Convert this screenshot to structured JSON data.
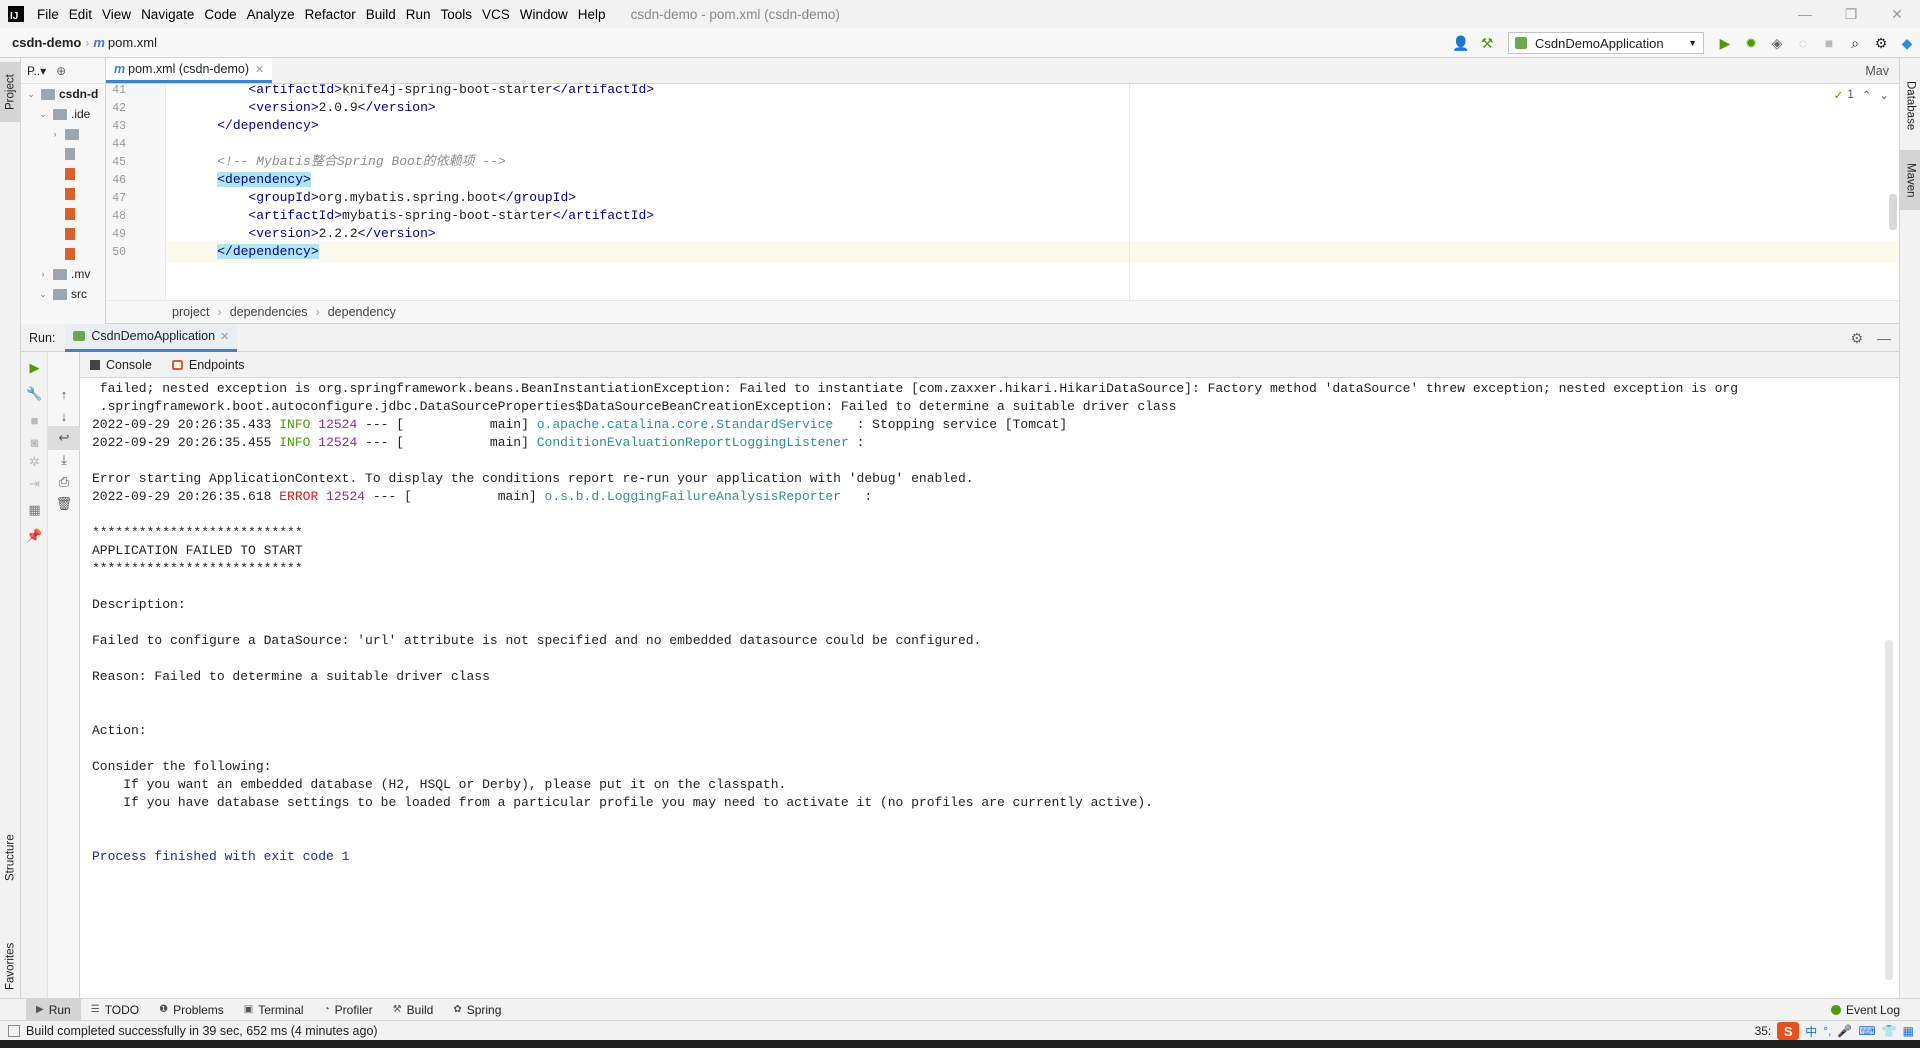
{
  "menubar": {
    "logo": "IJ",
    "items": [
      "File",
      "Edit",
      "View",
      "Navigate",
      "Code",
      "Analyze",
      "Refactor",
      "Build",
      "Run",
      "Tools",
      "VCS",
      "Window",
      "Help"
    ],
    "window_title": "csdn-demo - pom.xml (csdn-demo)"
  },
  "navbar": {
    "project": "csdn-demo",
    "file": "pom.xml",
    "run_config": "CsdnDemoApplication"
  },
  "side_tabs": {
    "project": "Project",
    "structure": "Structure",
    "favorites": "Favorites",
    "database": "Database",
    "maven": "Maven"
  },
  "project_panel": {
    "header": "P..▾",
    "rows": [
      {
        "arrow": "⌄",
        "label": "csdn-d",
        "kind": "folder",
        "bold": true
      },
      {
        "arrow": "⌄",
        "label": ".ide",
        "kind": "folder",
        "bold": false
      },
      {
        "arrow": "›",
        "label": "",
        "kind": "folder",
        "bold": false
      },
      {
        "arrow": "",
        "label": "",
        "kind": "gray",
        "bold": false
      },
      {
        "arrow": "",
        "label": "",
        "kind": "xml",
        "bold": false
      },
      {
        "arrow": "",
        "label": "",
        "kind": "xml",
        "bold": false
      },
      {
        "arrow": "",
        "label": "",
        "kind": "xml",
        "bold": false
      },
      {
        "arrow": "",
        "label": "",
        "kind": "xml",
        "bold": false
      },
      {
        "arrow": "",
        "label": "",
        "kind": "xml",
        "bold": false
      },
      {
        "arrow": "›",
        "label": ".mv",
        "kind": "folder",
        "bold": false
      },
      {
        "arrow": "⌄",
        "label": "src",
        "kind": "folder",
        "bold": false
      }
    ]
  },
  "editor": {
    "tab_label": "pom.xml (csdn-demo)",
    "right_label": "Mav",
    "inspection_count": "1",
    "lines": [
      {
        "num": "41",
        "indent": "        ",
        "open": "<artifactId>",
        "text": "knife4j-spring-boot-starter",
        "close": "</artifactId>"
      },
      {
        "num": "42",
        "indent": "        ",
        "open": "<version>",
        "text": "2.0.9",
        "close": "</version>"
      },
      {
        "num": "43",
        "indent": "    ",
        "open": "</dependency>",
        "text": "",
        "close": ""
      },
      {
        "num": "44",
        "indent": "",
        "open": "",
        "text": "",
        "close": ""
      },
      {
        "num": "45",
        "indent": "    ",
        "comment": "<!-- Mybatis整合Spring Boot的依赖项 -->"
      },
      {
        "num": "46",
        "indent": "    ",
        "open": "<dependency>",
        "text": "",
        "close": "",
        "highlight": true
      },
      {
        "num": "47",
        "indent": "        ",
        "open": "<groupId>",
        "text": "org.mybatis.spring.boot",
        "close": "</groupId>"
      },
      {
        "num": "48",
        "indent": "        ",
        "open": "<artifactId>",
        "text": "mybatis-spring-boot-starter",
        "close": "</artifactId>"
      },
      {
        "num": "49",
        "indent": "        ",
        "open": "<version>",
        "text": "2.2.2",
        "close": "</version>"
      },
      {
        "num": "50",
        "indent": "    ",
        "open": "</dependency>",
        "text": "",
        "close": "",
        "highlight": true
      }
    ],
    "breadcrumb": [
      "project",
      "dependencies",
      "dependency"
    ]
  },
  "run_window": {
    "title": "Run:",
    "tab": "CsdnDemoApplication",
    "console_tab": "Console",
    "endpoints_tab": "Endpoints"
  },
  "console": {
    "lines": [
      {
        "type": "plain",
        "text": " failed; nested exception is org.springframework.beans.BeanInstantiationException: Failed to instantiate [com.zaxxer.hikari.HikariDataSource]: Factory method 'dataSource' threw exception; nested exception is org"
      },
      {
        "type": "plain",
        "text": " .springframework.boot.autoconfigure.jdbc.DataSourceProperties$DataSourceBeanCreationException: Failed to determine a suitable driver class"
      },
      {
        "type": "log",
        "ts": "2022-09-29 20:26:35.433",
        "level": " INFO",
        "pid": "12524",
        "mid": " --- [           main] ",
        "logger": "o.apache.catalina.core.StandardService  ",
        "msg": " : Stopping service [Tomcat]"
      },
      {
        "type": "log",
        "ts": "2022-09-29 20:26:35.455",
        "level": " INFO",
        "pid": "12524",
        "mid": " --- [           main] ",
        "logger": "ConditionEvaluationReportLoggingListener",
        "msg": " :"
      },
      {
        "type": "plain",
        "text": ""
      },
      {
        "type": "plain",
        "text": "Error starting ApplicationContext. To display the conditions report re-run your application with 'debug' enabled."
      },
      {
        "type": "log",
        "ts": "2022-09-29 20:26:35.618",
        "level": " ERROR",
        "pid": "12524",
        "mid": " --- [           main] ",
        "logger": "o.s.b.d.LoggingFailureAnalysisReporter  ",
        "msg": " :"
      },
      {
        "type": "plain",
        "text": ""
      },
      {
        "type": "plain",
        "text": "***************************"
      },
      {
        "type": "plain",
        "text": "APPLICATION FAILED TO START"
      },
      {
        "type": "plain",
        "text": "***************************"
      },
      {
        "type": "plain",
        "text": ""
      },
      {
        "type": "plain",
        "text": "Description:"
      },
      {
        "type": "plain",
        "text": ""
      },
      {
        "type": "plain",
        "text": "Failed to configure a DataSource: 'url' attribute is not specified and no embedded datasource could be configured."
      },
      {
        "type": "plain",
        "text": ""
      },
      {
        "type": "plain",
        "text": "Reason: Failed to determine a suitable driver class"
      },
      {
        "type": "plain",
        "text": ""
      },
      {
        "type": "plain",
        "text": ""
      },
      {
        "type": "plain",
        "text": "Action:"
      },
      {
        "type": "plain",
        "text": ""
      },
      {
        "type": "plain",
        "text": "Consider the following:"
      },
      {
        "type": "plain",
        "text": "    If you want an embedded database (H2, HSQL or Derby), please put it on the classpath."
      },
      {
        "type": "plain",
        "text": "    If you have database settings to be loaded from a particular profile you may need to activate it (no profiles are currently active)."
      },
      {
        "type": "plain",
        "text": ""
      },
      {
        "type": "plain",
        "text": ""
      },
      {
        "type": "exit",
        "text": "Process finished with exit code 1"
      }
    ]
  },
  "bottom_bar": {
    "tabs": [
      {
        "icon": "▶",
        "label": "Run"
      },
      {
        "icon": "☰",
        "label": "TODO"
      },
      {
        "icon": "❶",
        "label": "Problems"
      },
      {
        "icon": "▣",
        "label": "Terminal"
      },
      {
        "icon": "◔",
        "label": "Profiler"
      },
      {
        "icon": "⚒",
        "label": "Build"
      },
      {
        "icon": "✿",
        "label": "Spring"
      }
    ],
    "event_log": "Event Log"
  },
  "status_bar": {
    "message": "Build completed successfully in 39 sec, 652 ms (4 minutes ago)",
    "position": "35:",
    "ime_logo": "S",
    "ime_lang": "中"
  },
  "colors": {
    "accent": "#4083c9",
    "info": "#4e9a06",
    "error": "#cc2222",
    "pid": "#a020a0",
    "logger": "#2f8f9a",
    "xml_tag": "#00008b"
  }
}
